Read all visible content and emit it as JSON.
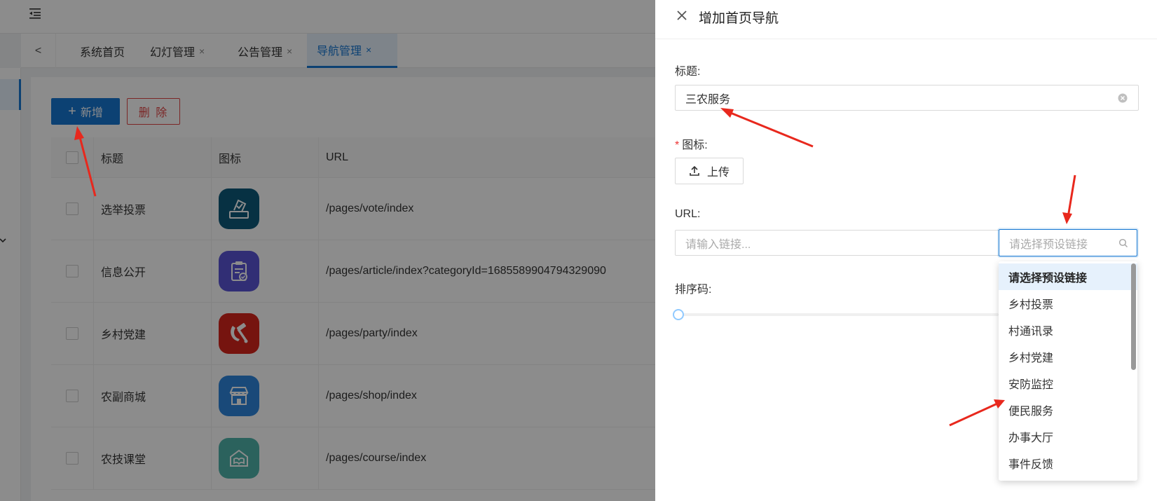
{
  "tabs": {
    "back_glyph": "<",
    "items": [
      {
        "label": "系统首页",
        "closable": false
      },
      {
        "label": "幻灯管理",
        "closable": true
      },
      {
        "label": "公告管理",
        "closable": true
      },
      {
        "label": "导航管理",
        "closable": true,
        "active": true
      }
    ],
    "close_glyph": "×"
  },
  "toolbar": {
    "add_label": "新增",
    "add_glyph": "+",
    "delete_label": "删 除"
  },
  "table": {
    "headers": {
      "title": "标题",
      "icon": "图标",
      "url": "URL"
    },
    "rows": [
      {
        "title": "选举投票",
        "icon": "vote-icon",
        "color": "#0e5a7a",
        "url": "/pages/vote/index"
      },
      {
        "title": "信息公开",
        "icon": "clipboard-check-icon",
        "color": "#5a55d6",
        "url": "/pages/article/index?categoryId=1685589904794329090"
      },
      {
        "title": "乡村党建",
        "icon": "party-emblem-icon",
        "color": "#d8261d",
        "url": "/pages/party/index"
      },
      {
        "title": "农副商城",
        "icon": "shop-icon",
        "color": "#2f86dd",
        "url": "/pages/shop/index"
      },
      {
        "title": "农技课堂",
        "icon": "course-icon",
        "color": "#4fb3a9",
        "url": "/pages/course/index"
      }
    ]
  },
  "drawer": {
    "title": "增加首页导航",
    "close_glyph": "×",
    "form": {
      "title_label": "标题:",
      "title_value": "三农服务",
      "icon_label": "图标:",
      "icon_required_mark": "*",
      "upload_label": "上传",
      "url_label": "URL:",
      "url_placeholder": "请输入链接...",
      "preset_placeholder": "请选择预设链接",
      "sort_label": "排序码:",
      "sort_value": 0
    },
    "dropdown": {
      "options": [
        "请选择预设链接",
        "乡村投票",
        "村通讯录",
        "乡村党建",
        "安防监控",
        "便民服务",
        "办事大厅",
        "事件反馈"
      ],
      "highlighted_index": 0
    }
  },
  "colors": {
    "primary": "#1677d2",
    "danger": "#e04646",
    "arrow": "#e8281d"
  }
}
